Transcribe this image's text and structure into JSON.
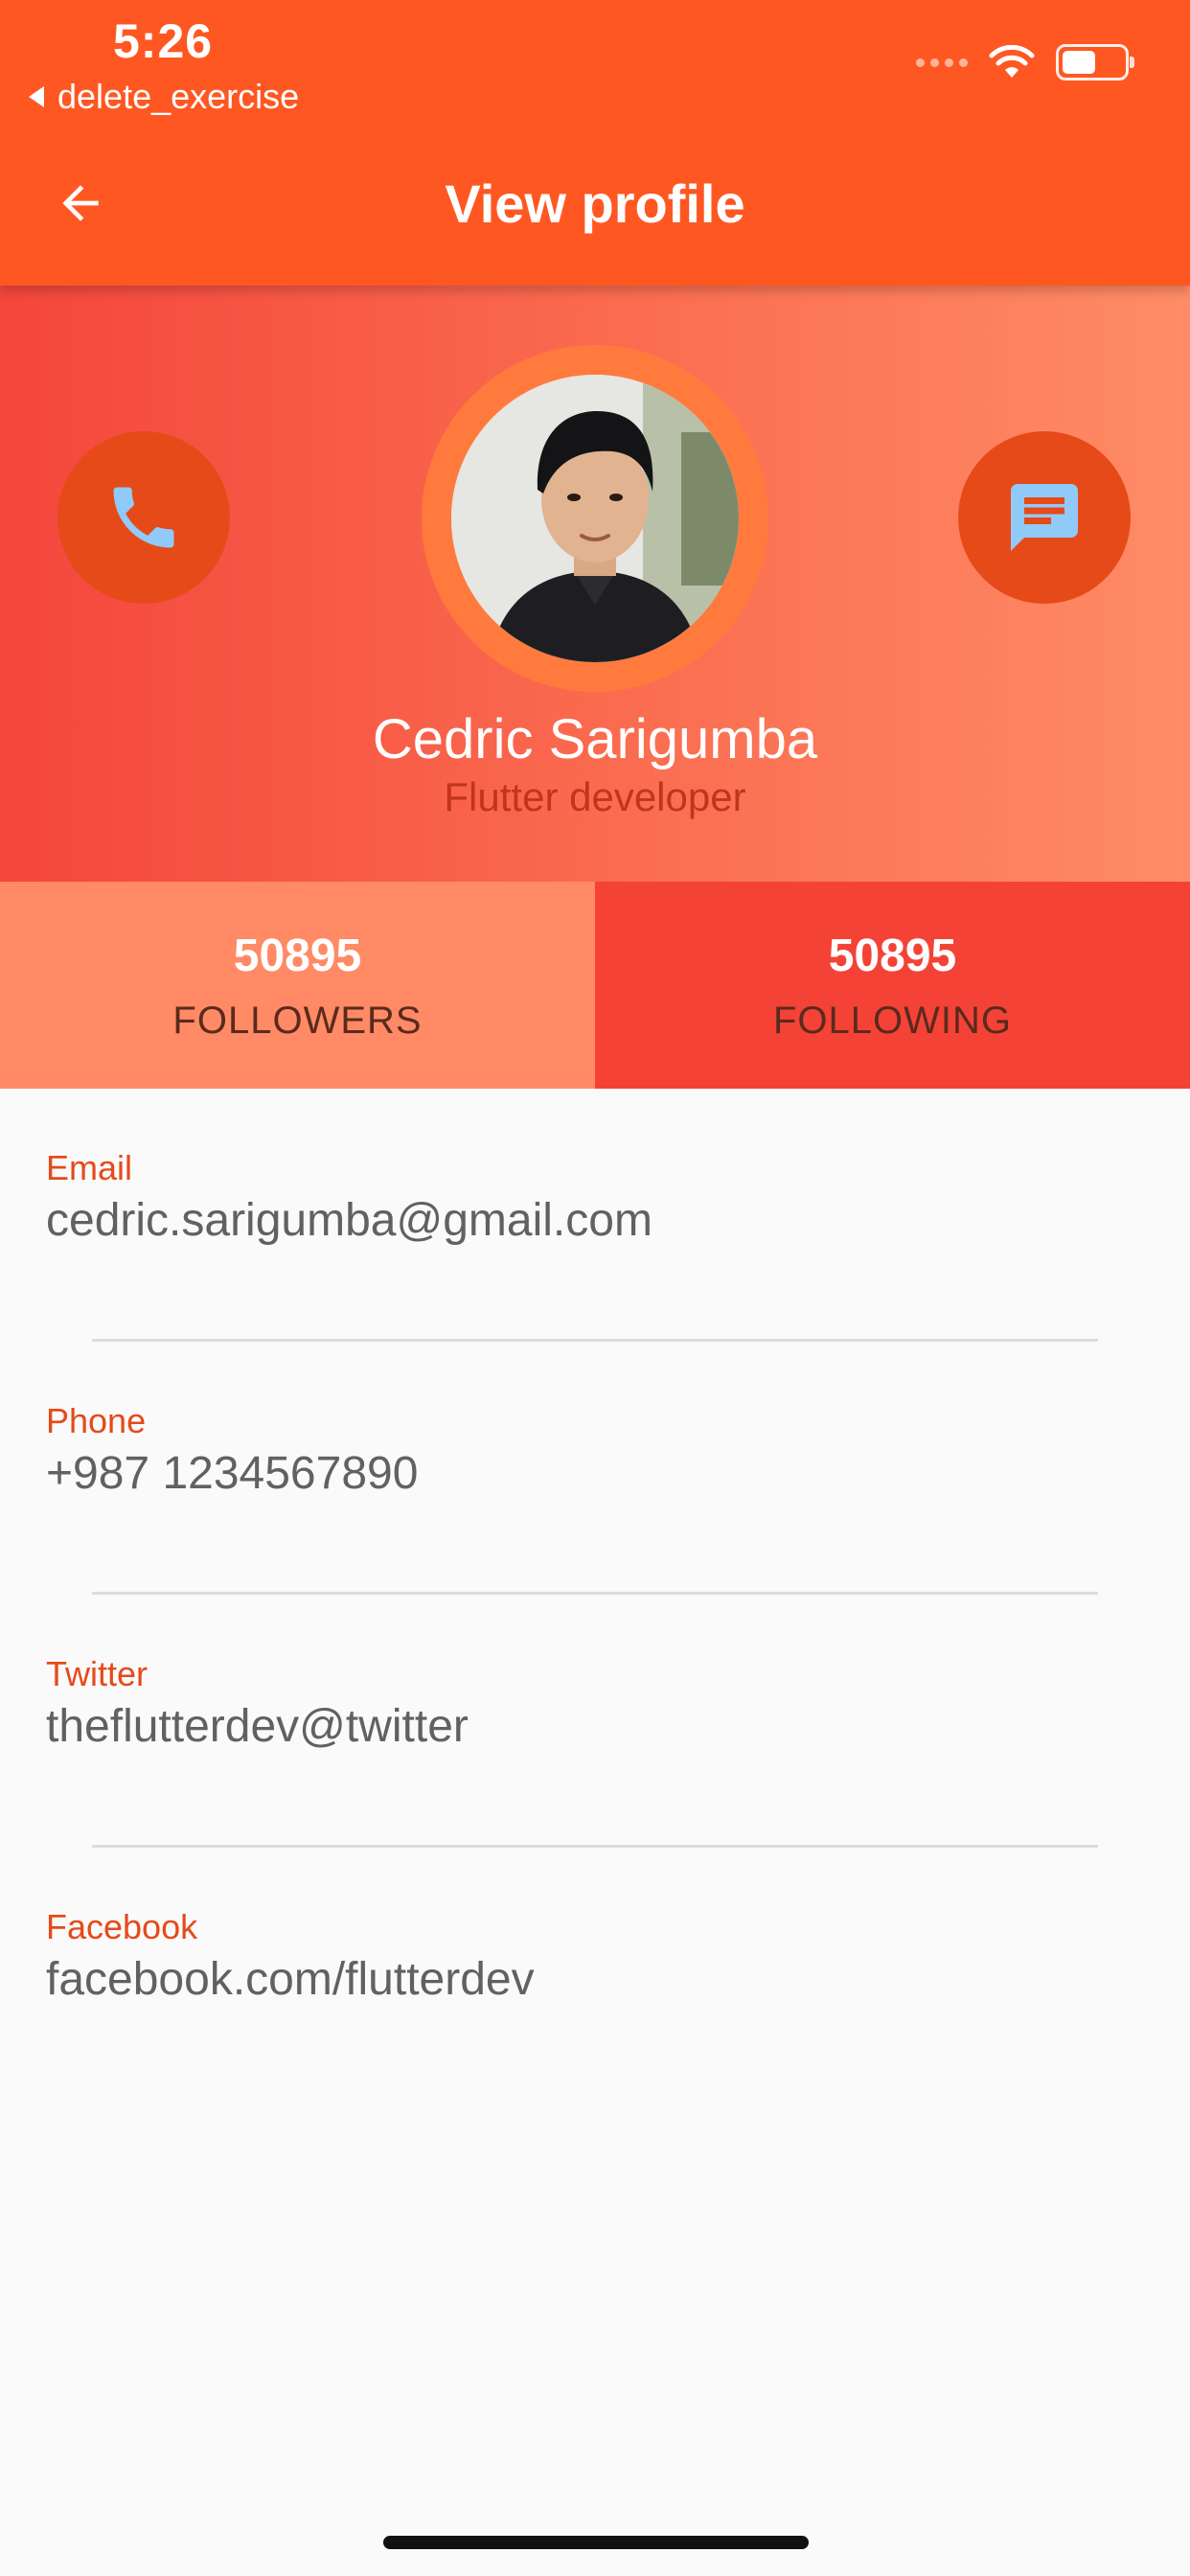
{
  "status_bar": {
    "time": "5:26",
    "back_app": "delete_exercise",
    "battery_level": 0.55
  },
  "app_bar": {
    "title": "View profile",
    "back_icon": "arrow-back-icon"
  },
  "profile": {
    "name": "Cedric Sarigumba",
    "role": "Flutter developer",
    "call_icon": "phone-icon",
    "message_icon": "chat-bubble-icon"
  },
  "stats": {
    "followers": {
      "value": "50895",
      "label": "FOLLOWERS"
    },
    "following": {
      "value": "50895",
      "label": "FOLLOWING"
    }
  },
  "info": [
    {
      "label": "Email",
      "value": "cedric.sarigumba@gmail.com"
    },
    {
      "label": "Phone",
      "value": "+987 1234567890"
    },
    {
      "label": "Twitter",
      "value": "theflutterdev@twitter"
    },
    {
      "label": "Facebook",
      "value": "facebook.com/flutterdev"
    }
  ],
  "colors": {
    "primary": "#ff5722",
    "accent_button": "#e64a19",
    "followers_bg": "#ff8a65",
    "following_bg": "#f44336",
    "icon_light": "#90caf9"
  }
}
